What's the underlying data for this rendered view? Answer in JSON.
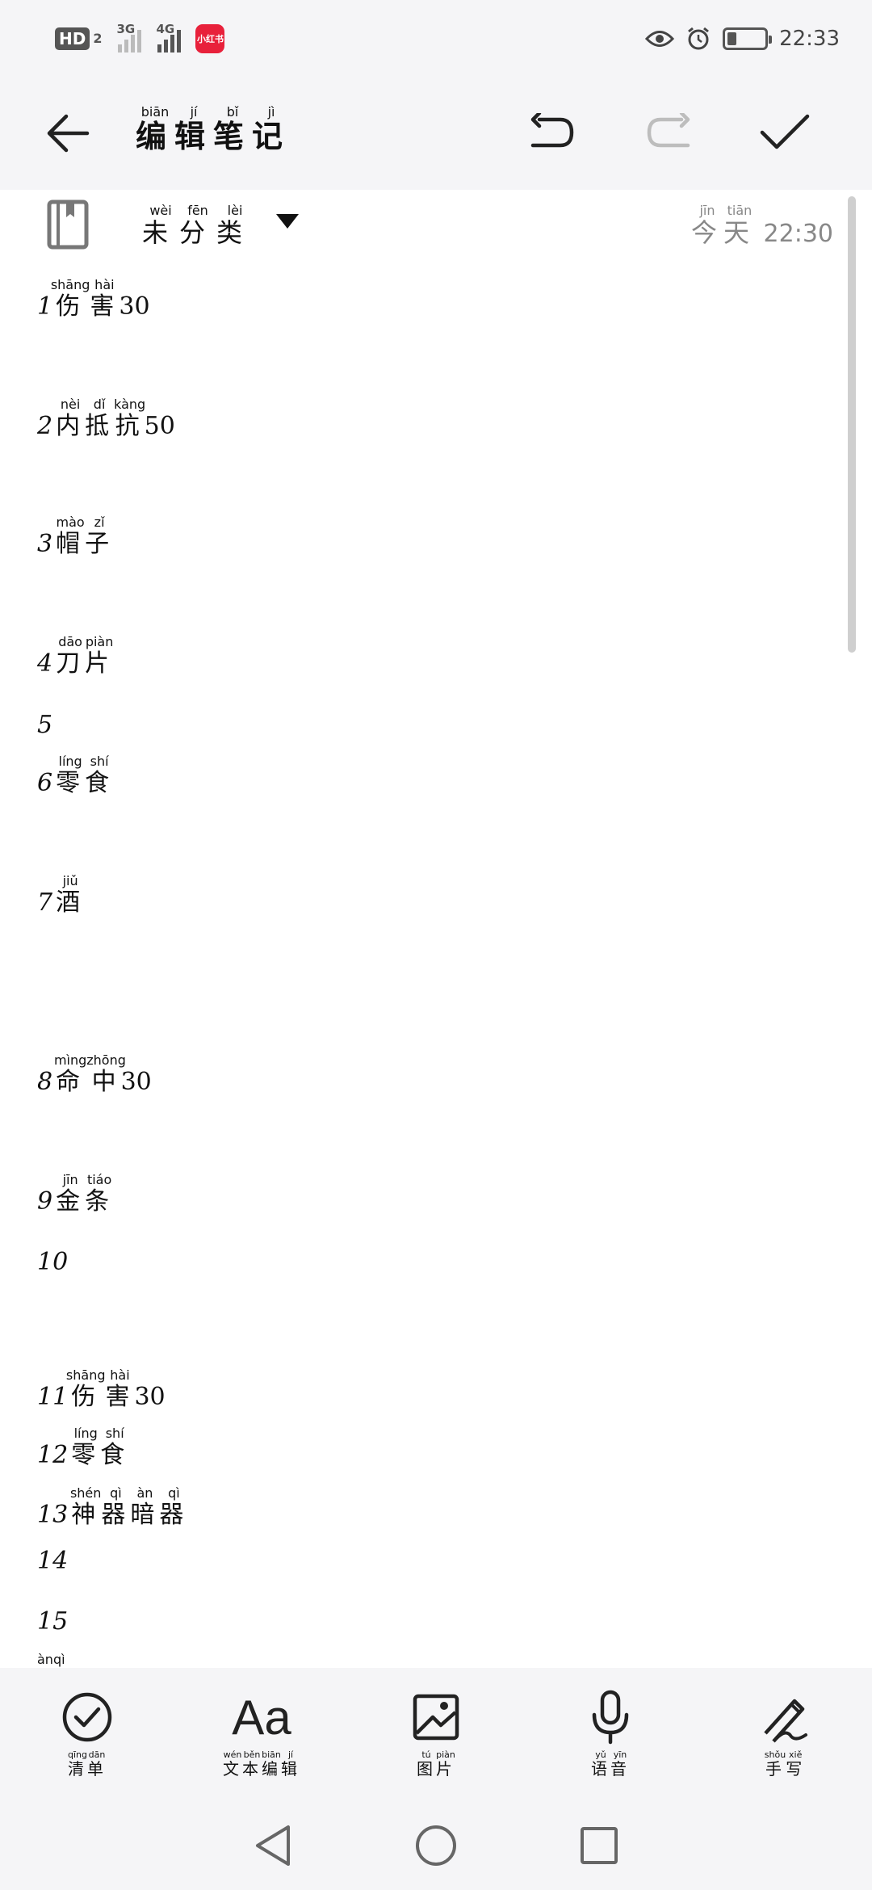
{
  "status_bar": {
    "hd": "HD",
    "hd_sub": "2",
    "net1": "3G",
    "net2": "4G",
    "app_badge": "小红书",
    "time": "22:33",
    "battery_level": 0.25
  },
  "toolbar": {
    "title": [
      {
        "c": "编",
        "p": "biān"
      },
      {
        "c": "辑",
        "p": "jí"
      },
      {
        "c": "笔",
        "p": "bǐ"
      },
      {
        "c": "记",
        "p": "jì"
      }
    ]
  },
  "meta": {
    "category": [
      {
        "c": "未",
        "p": "wèi"
      },
      {
        "c": "分",
        "p": "fēn"
      },
      {
        "c": "类",
        "p": "lèi"
      }
    ],
    "date": [
      {
        "c": "今",
        "p": "jīn"
      },
      {
        "c": "天",
        "p": "tiān"
      }
    ],
    "time": "22:30"
  },
  "note_lines": [
    {
      "num": "1",
      "chars": [
        {
          "c": "伤",
          "p": "shāng"
        },
        {
          "c": "害",
          "p": "hài"
        }
      ],
      "suffix": "30"
    },
    {
      "num": "2",
      "chars": [
        {
          "c": "内",
          "p": "nèi"
        },
        {
          "c": "抵",
          "p": "dǐ"
        },
        {
          "c": "抗",
          "p": "kàng"
        }
      ],
      "suffix": "50"
    },
    {
      "num": "3",
      "chars": [
        {
          "c": "帽",
          "p": "mào"
        },
        {
          "c": "子",
          "p": "zǐ"
        }
      ],
      "suffix": ""
    },
    {
      "num": "4",
      "chars": [
        {
          "c": "刀",
          "p": "dāo"
        },
        {
          "c": "片",
          "p": "piàn"
        }
      ],
      "suffix": ""
    },
    {
      "num": "5",
      "chars": [],
      "suffix": ""
    },
    {
      "num": "6",
      "chars": [
        {
          "c": "零",
          "p": "líng"
        },
        {
          "c": "食",
          "p": "shí"
        }
      ],
      "suffix": ""
    },
    {
      "num": "7",
      "chars": [
        {
          "c": "酒",
          "p": "jiǔ"
        }
      ],
      "suffix": ""
    },
    {
      "num": "8",
      "chars": [
        {
          "c": "命",
          "p": "mìng"
        },
        {
          "c": "中",
          "p": "zhōng"
        }
      ],
      "suffix": "30"
    },
    {
      "num": "9",
      "chars": [
        {
          "c": "金",
          "p": "jīn"
        },
        {
          "c": "条",
          "p": "tiáo"
        }
      ],
      "suffix": ""
    },
    {
      "num": "10",
      "chars": [],
      "suffix": ""
    },
    {
      "num": "11",
      "chars": [
        {
          "c": "伤",
          "p": "shāng"
        },
        {
          "c": "害",
          "p": "hài"
        }
      ],
      "suffix": "30"
    },
    {
      "num": "12",
      "chars": [
        {
          "c": "零",
          "p": "líng"
        },
        {
          "c": "食",
          "p": "shí"
        }
      ],
      "suffix": ""
    },
    {
      "num": "13",
      "chars": [
        {
          "c": "神",
          "p": "shén"
        },
        {
          "c": "器",
          "p": "qì"
        },
        {
          "c": "暗",
          "p": "àn"
        },
        {
          "c": "器",
          "p": "qì"
        }
      ],
      "suffix": ""
    },
    {
      "num": "14",
      "chars": [],
      "suffix": ""
    },
    {
      "num": "15",
      "chars": [],
      "suffix": ""
    },
    {
      "num": "",
      "chars": [
        {
          "c": "",
          "p": "àn"
        },
        {
          "c": "",
          "p": "qì"
        }
      ],
      "suffix": ""
    }
  ],
  "bottom_tools": [
    {
      "name": "checklist",
      "label": [
        {
          "c": "清",
          "p": "qīng"
        },
        {
          "c": "单",
          "p": "dān"
        }
      ]
    },
    {
      "name": "text-edit",
      "glyph": "Aa",
      "label": [
        {
          "c": "文",
          "p": "wén"
        },
        {
          "c": "本",
          "p": "běn"
        },
        {
          "c": "编",
          "p": "biān"
        },
        {
          "c": "辑",
          "p": "jí"
        }
      ]
    },
    {
      "name": "image",
      "label": [
        {
          "c": "图",
          "p": "tú"
        },
        {
          "c": "片",
          "p": "piàn"
        }
      ]
    },
    {
      "name": "voice",
      "label": [
        {
          "c": "语",
          "p": "yǔ"
        },
        {
          "c": "音",
          "p": "yīn"
        }
      ]
    },
    {
      "name": "handwriting",
      "label": [
        {
          "c": "手",
          "p": "shǒu"
        },
        {
          "c": "写",
          "p": "xiě"
        }
      ]
    }
  ]
}
